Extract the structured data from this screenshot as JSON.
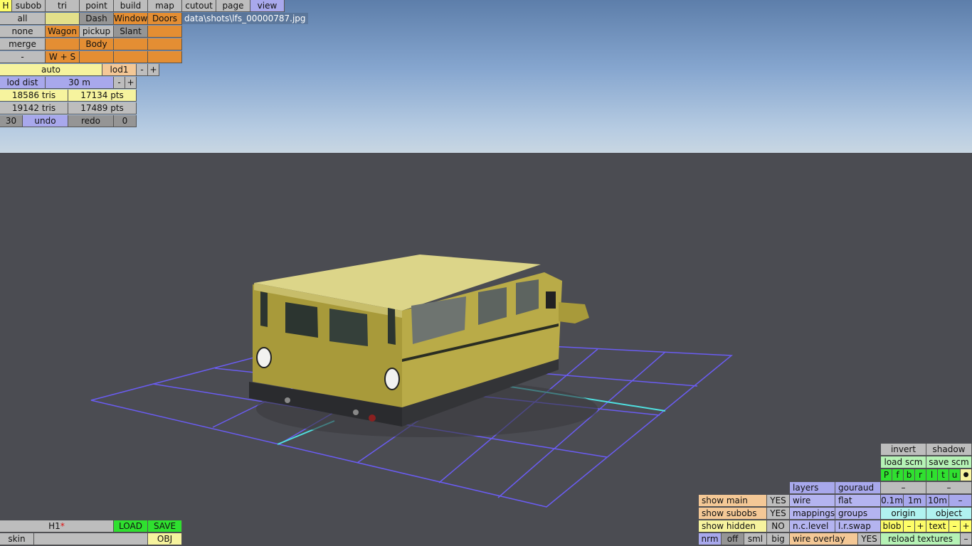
{
  "filepath": "data\\shots\\lfs_00000787.jpg",
  "top_tabs": [
    "H",
    "subob",
    "tri",
    "point",
    "build",
    "map",
    "cutout",
    "page",
    "view"
  ],
  "sel": {
    "all": "all",
    "none": "none",
    "merge": "merge",
    "dash": "-"
  },
  "subobs": {
    "dash": "Dash",
    "windows": "Windows",
    "doors": "Doors",
    "wagon": "Wagon",
    "pickup": "pickup",
    "slant": "Slant",
    "body": "Body",
    "ws": "W + S"
  },
  "lod": {
    "auto": "auto",
    "lod1": "lod1",
    "minus": "-",
    "plus": "+",
    "dist_label": "lod dist",
    "dist_value": "30 m"
  },
  "stats": {
    "tris1": "18586 tris",
    "pts1": "17134 pts",
    "tris2": "19142 tris",
    "pts2": "17489 pts"
  },
  "history": {
    "count": "30",
    "undo": "undo",
    "redo": "redo",
    "zero": "0"
  },
  "bottom_left": {
    "name": "H1",
    "modified": "*",
    "load": "LOAD",
    "save": "SAVE",
    "skin": "skin",
    "obj": "OBJ"
  },
  "right_panel": {
    "invert": "invert",
    "shadow": "shadow",
    "load_scm": "load scm",
    "save_scm": "save scm",
    "letters": [
      "P",
      "f",
      "b",
      "r",
      "l",
      "t",
      "u"
    ],
    "dot": "●",
    "layers": "layers",
    "gouraud": "gouraud",
    "minus": "–",
    "show_main": "show main",
    "show_main_v": "YES",
    "show_subobs": "show subobs",
    "show_subobs_v": "YES",
    "show_hidden": "show hidden",
    "show_hidden_v": "NO",
    "wire": "wire",
    "flat": "flat",
    "mappings": "mappings",
    "groups": "groups",
    "nc_level": "n.c.level",
    "lr_swap": "l.r.swap",
    "grid": [
      "0.1m",
      "1m",
      "10m"
    ],
    "dash": "–",
    "origin": "origin",
    "object": "object",
    "blob": "blob",
    "text": "text",
    "plus": "+",
    "nrm": "nrm",
    "off": "off",
    "sml": "sml",
    "big": "big",
    "wire_overlay": "wire overlay",
    "wire_overlay_v": "YES",
    "reload_textures": "reload textures"
  }
}
